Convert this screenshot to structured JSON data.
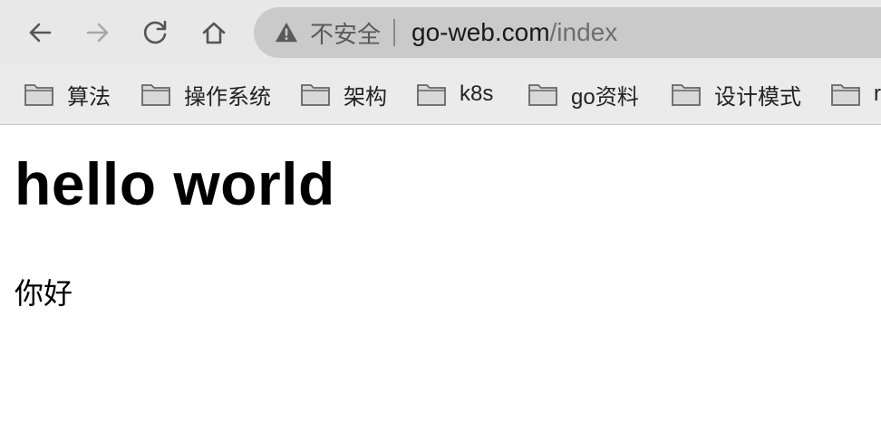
{
  "toolbar": {
    "back_icon": "back-arrow-icon",
    "forward_icon": "forward-arrow-icon",
    "reload_icon": "reload-icon",
    "home_icon": "home-icon"
  },
  "address_bar": {
    "security_icon": "warning-icon",
    "security_label": "不安全",
    "url_host": "go-web.com",
    "url_path": "/index"
  },
  "bookmarks": [
    {
      "label": "算法",
      "icon": "folder-icon"
    },
    {
      "label": "操作系统",
      "icon": "folder-icon"
    },
    {
      "label": "架构",
      "icon": "folder-icon"
    },
    {
      "label": "k8s",
      "icon": "folder-icon"
    },
    {
      "label": "go资料",
      "icon": "folder-icon"
    },
    {
      "label": "设计模式",
      "icon": "folder-icon"
    },
    {
      "label": "r",
      "icon": "folder-icon"
    }
  ],
  "page": {
    "heading": "hello world",
    "paragraph": "你好"
  },
  "colors": {
    "toolbar_bg": "#e8e8e8",
    "address_bar_bg": "#cacaca",
    "page_bg": "#ffffff"
  }
}
